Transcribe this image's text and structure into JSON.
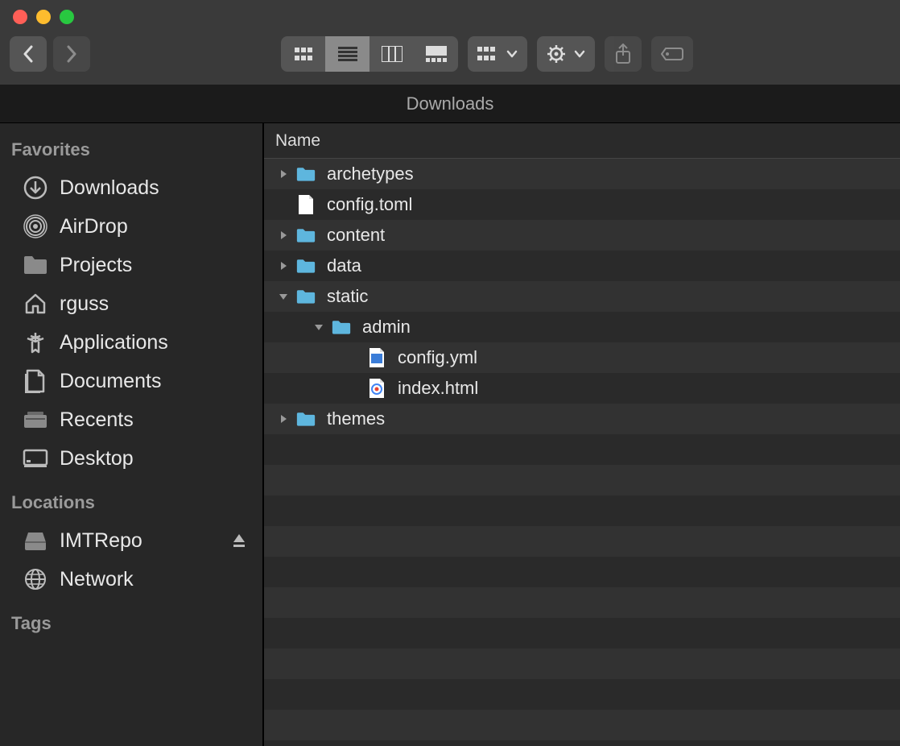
{
  "window_title": "Downloads",
  "column_header": "Name",
  "sidebar": {
    "sections": [
      {
        "heading": "Favorites",
        "items": [
          {
            "label": "Downloads",
            "icon": "download"
          },
          {
            "label": "AirDrop",
            "icon": "airdrop"
          },
          {
            "label": "Projects",
            "icon": "folder"
          },
          {
            "label": "rguss",
            "icon": "home"
          },
          {
            "label": "Applications",
            "icon": "apps"
          },
          {
            "label": "Documents",
            "icon": "docs"
          },
          {
            "label": "Recents",
            "icon": "recents"
          },
          {
            "label": "Desktop",
            "icon": "desktop"
          }
        ]
      },
      {
        "heading": "Locations",
        "items": [
          {
            "label": "IMTRepo",
            "icon": "drive",
            "eject": true
          },
          {
            "label": "Network",
            "icon": "network"
          }
        ]
      },
      {
        "heading": "Tags",
        "items": []
      }
    ]
  },
  "files": [
    {
      "name": "archetypes",
      "type": "folder",
      "expanded": false,
      "depth": 0
    },
    {
      "name": "config.toml",
      "type": "file-generic",
      "depth": 0
    },
    {
      "name": "content",
      "type": "folder",
      "expanded": false,
      "depth": 0
    },
    {
      "name": "data",
      "type": "folder",
      "expanded": false,
      "depth": 0
    },
    {
      "name": "static",
      "type": "folder",
      "expanded": true,
      "depth": 0
    },
    {
      "name": "admin",
      "type": "folder",
      "expanded": true,
      "depth": 1
    },
    {
      "name": "config.yml",
      "type": "file-yml",
      "depth": 2
    },
    {
      "name": "index.html",
      "type": "file-html",
      "depth": 2
    },
    {
      "name": "themes",
      "type": "folder",
      "expanded": false,
      "depth": 0
    }
  ],
  "blank_rows": 10
}
